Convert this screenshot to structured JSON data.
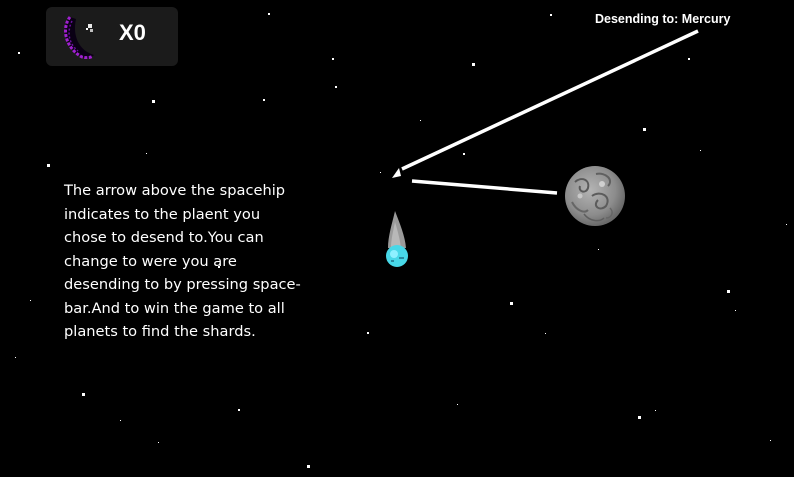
{
  "hud": {
    "shard_icon": "purple-crescent-shard-icon",
    "shard_count": "X0",
    "descending_label": "Desending to: Mercury"
  },
  "instructions": {
    "lines": [
      "The arrow above the spacehip",
      "indicates to the plaent you",
      "chose to desend to.You can",
      "change to were you are",
      "desending to by pressing space-",
      "bar.And to win the game to all",
      "planets to find the shards."
    ]
  },
  "target_planet": {
    "name": "Mercury"
  },
  "colors": {
    "background": "#000000",
    "text": "#ffffff",
    "hud_panel": "#1b1b1b",
    "shard_purple": "#a020d0",
    "planet_gray": "#8a8a8a",
    "ship_cyan": "#48d8e8",
    "ship_flame": "#9a9a9a"
  }
}
